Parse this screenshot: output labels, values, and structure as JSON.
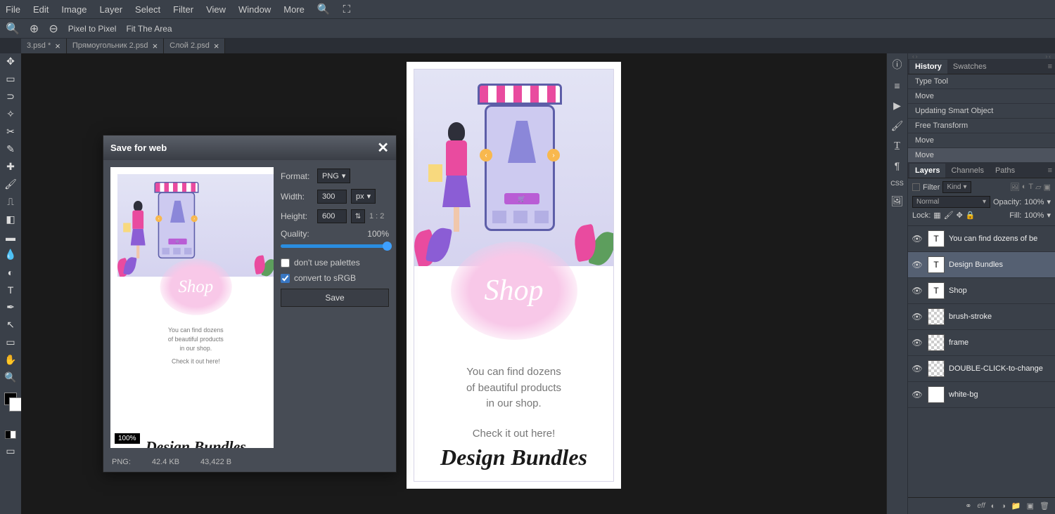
{
  "menu": {
    "file": "File",
    "edit": "Edit",
    "image": "Image",
    "layer": "Layer",
    "select": "Select",
    "filter": "Filter",
    "view": "View",
    "window": "Window",
    "more": "More"
  },
  "options": {
    "pixel": "Pixel to Pixel",
    "fit": "Fit The Area"
  },
  "tabs": [
    {
      "label": "3.psd *"
    },
    {
      "label": "Прямоугольник 2.psd"
    },
    {
      "label": "Слой 2.psd"
    }
  ],
  "dialog": {
    "title": "Save for web",
    "format_label": "Format:",
    "format_value": "PNG",
    "width_label": "Width:",
    "width_value": "300",
    "width_unit": "px",
    "height_label": "Height:",
    "height_value": "600",
    "ratio": "1 : 2",
    "quality_label": "Quality:",
    "quality_value": "100%",
    "palettes": "don't use palettes",
    "srgb": "convert to sRGB",
    "save": "Save",
    "zoom": "100%",
    "footer_format": "PNG:",
    "footer_size": "42.4 KB",
    "footer_bytes": "43,422 B"
  },
  "artwork": {
    "shop": "Shop",
    "body1": "You can find dozens",
    "body2": "of beautiful products",
    "body3": "in our shop.",
    "check": "Check it out here!",
    "sig": "Design Bundles",
    "cart": "🛒"
  },
  "history": {
    "tab1": "History",
    "tab2": "Swatches",
    "items": [
      "Type Tool",
      "Move",
      "Updating Smart Object",
      "Free Transform",
      "Move",
      "Move"
    ]
  },
  "layers_panel": {
    "tab1": "Layers",
    "tab2": "Channels",
    "tab3": "Paths",
    "filter": "Filter",
    "kind": "Kind",
    "blend": "Normal",
    "opacity_l": "Opacity:",
    "opacity_v": "100%",
    "lock": "Lock:",
    "fill_l": "Fill:",
    "fill_v": "100%"
  },
  "layers": [
    {
      "name": "You can find dozens of be",
      "type": "T"
    },
    {
      "name": "Design Bundles",
      "type": "T",
      "active": true
    },
    {
      "name": "Shop",
      "type": "T"
    },
    {
      "name": "brush-stroke",
      "type": "checker"
    },
    {
      "name": "frame",
      "type": "checker"
    },
    {
      "name": "DOUBLE-CLICK-to-change",
      "type": "checker"
    },
    {
      "name": "white-bg",
      "type": "white"
    }
  ],
  "footer_icons": {
    "link": "⬤⬤",
    "fx": "eff"
  }
}
